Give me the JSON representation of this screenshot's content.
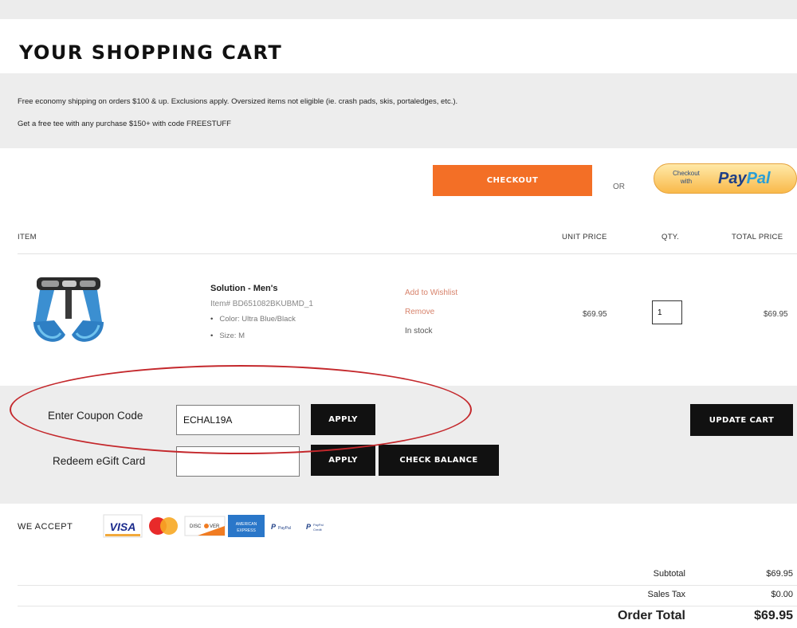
{
  "page": {
    "title": "YOUR SHOPPING CART"
  },
  "promo": {
    "line1": "Free economy shipping on orders $100 & up. Exclusions apply. Oversized items not eligible (ie. crash pads, skis, portaledges, etc.).",
    "line2": "Get a free tee with any purchase $150+ with code FREESTUFF"
  },
  "actions": {
    "checkout_label": "CHECKOUT",
    "or_label": "OR",
    "paypal_small": "Checkout with",
    "paypal_brand_a": "Pay",
    "paypal_brand_b": "Pal"
  },
  "table": {
    "headers": {
      "item": "ITEM",
      "unit_price": "UNIT PRICE",
      "qty": "QTY.",
      "total_price": "TOTAL PRICE"
    },
    "item": {
      "name": "Solution - Men's",
      "sku": "Item# BD651082BKUBMD_1",
      "color": "Color: Ultra Blue/Black",
      "size": "Size: M",
      "add_to_wishlist": "Add to Wishlist",
      "remove": "Remove",
      "stock": "In stock",
      "unit_price": "$69.95",
      "qty": "1",
      "total_price": "$69.95"
    }
  },
  "coupon": {
    "coupon_label": "Enter Coupon Code",
    "coupon_value": "ECHAL19A",
    "apply_label": "APPLY",
    "egift_label": "Redeem eGift Card",
    "egift_value": "",
    "egift_apply_label": "APPLY",
    "check_balance_label": "CHECK BALANCE",
    "update_cart_label": "UPDATE CART"
  },
  "payment": {
    "we_accept_label": "WE ACCEPT",
    "methods": [
      "VISA",
      "MasterCard",
      "DISCOVER",
      "AMERICAN EXPRESS",
      "PayPal",
      "PayPal Credit"
    ]
  },
  "summary": {
    "subtotal_label": "Subtotal",
    "subtotal_value": "$69.95",
    "tax_label": "Sales Tax",
    "tax_value": "$0.00",
    "total_label": "Order Total",
    "total_value": "$69.95"
  },
  "colors": {
    "checkout": "#f36f26",
    "accent_red": "#c4282c",
    "link": "#d7826b"
  }
}
